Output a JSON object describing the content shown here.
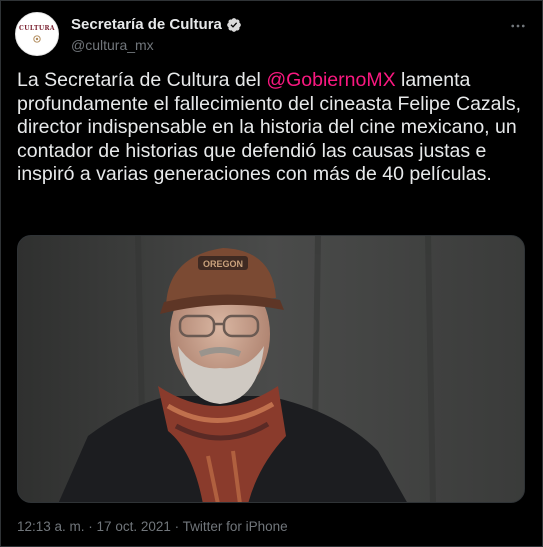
{
  "account": {
    "display_name": "Secretaría de Cultura",
    "handle": "@cultura_mx",
    "avatar_text": "CULTURA",
    "verified": true,
    "verified_color": "#d9d9d9"
  },
  "tweet": {
    "text_before": "La Secretaría de Cultura del ",
    "mention": "@GobiernoMX",
    "text_after": " lamenta profundamente el fallecimiento del cineasta Felipe Cazals, director indispensable en la historia del cine mexicano, un contador de historias que defendió las causas justas e inspiró a varias generaciones con más de 40 películas.",
    "mention_color": "#f91880",
    "photo": {
      "cap_text": "OREGON"
    }
  },
  "meta": {
    "time": "12:13 a. m.",
    "separator": " · ",
    "date": "17 oct. 2021",
    "source": "Twitter for iPhone"
  },
  "icons": {
    "more": "more-options-icon",
    "verified": "verified-badge-icon"
  }
}
